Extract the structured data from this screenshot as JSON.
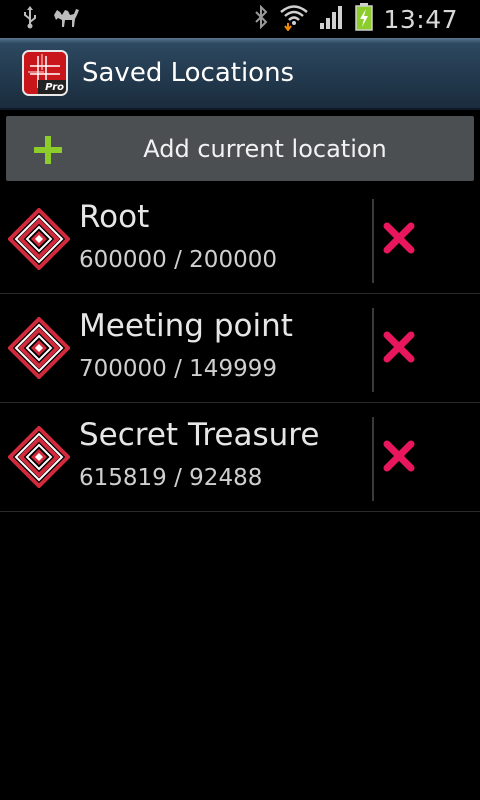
{
  "status_bar": {
    "time": "13:47",
    "icons": [
      "usb-icon",
      "camel-icon",
      "bluetooth-icon",
      "wifi-icon",
      "signal-icon",
      "battery-charging-icon"
    ]
  },
  "header": {
    "app_icon": "compass-grid-pro-icon",
    "app_icon_badge": "Pro",
    "title": "Saved Locations"
  },
  "add_button": {
    "icon": "plus-icon",
    "label": "Add current location"
  },
  "locations": [
    {
      "name": "Root",
      "coords": "600000 / 200000"
    },
    {
      "name": "Meeting point",
      "coords": "700000 / 149999"
    },
    {
      "name": "Secret Treasure",
      "coords": "615819 / 92488"
    }
  ],
  "colors": {
    "title_bar": "#22384c",
    "button_bg": "#4c4f51",
    "delete": "#e8175d",
    "plus": "#8ccd2c",
    "marker": "#c0283a"
  }
}
